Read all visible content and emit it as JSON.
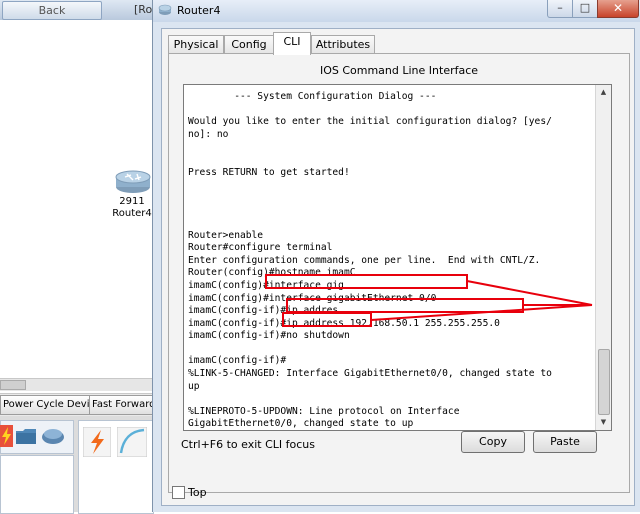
{
  "background_window": {
    "back_button": "Back",
    "title_fragment": "[Roo",
    "device": {
      "model": "2911",
      "name": "Router4"
    },
    "toolbar": {
      "power_cycle": "Power Cycle Devices",
      "fast_forward": "Fast Forward T"
    }
  },
  "window": {
    "title": "Router4"
  },
  "tabs": [
    {
      "label": "Physical"
    },
    {
      "label": "Config"
    },
    {
      "label": "CLI"
    },
    {
      "label": "Attributes"
    }
  ],
  "panel_heading": "IOS Command Line Interface",
  "cli": {
    "lines": "        --- System Configuration Dialog ---\n\nWould you like to enter the initial configuration dialog? [yes/\nno]: no\n\n\nPress RETURN to get started!\n\n\n\n\nRouter>enable\nRouter#configure terminal\nEnter configuration commands, one per line.  End with CNTL/Z.\nRouter(config)#hostname imamC\nimamC(config)#interface gig\nimamC(config)#interface gigabitEthernet 0/0\nimamC(config-if)#ip addres\nimamC(config-if)#ip address 192.168.50.1 255.255.255.0\nimamC(config-if)#no shutdown\n\nimamC(config-if)#\n%LINK-5-CHANGED: Interface GigabitEthernet0/0, changed state to\nup\n\n%LINEPROTO-5-UPDOWN: Line protocol on Interface\nGigabitEthernet0/0, changed state to up"
  },
  "hint": "Ctrl+F6 to exit CLI focus",
  "buttons": {
    "copy": "Copy",
    "paste": "Paste"
  },
  "top_checkbox": {
    "label": "Top",
    "checked": false
  },
  "colors": {
    "annotation": "#e8000c",
    "close_button": "#c8432a"
  }
}
